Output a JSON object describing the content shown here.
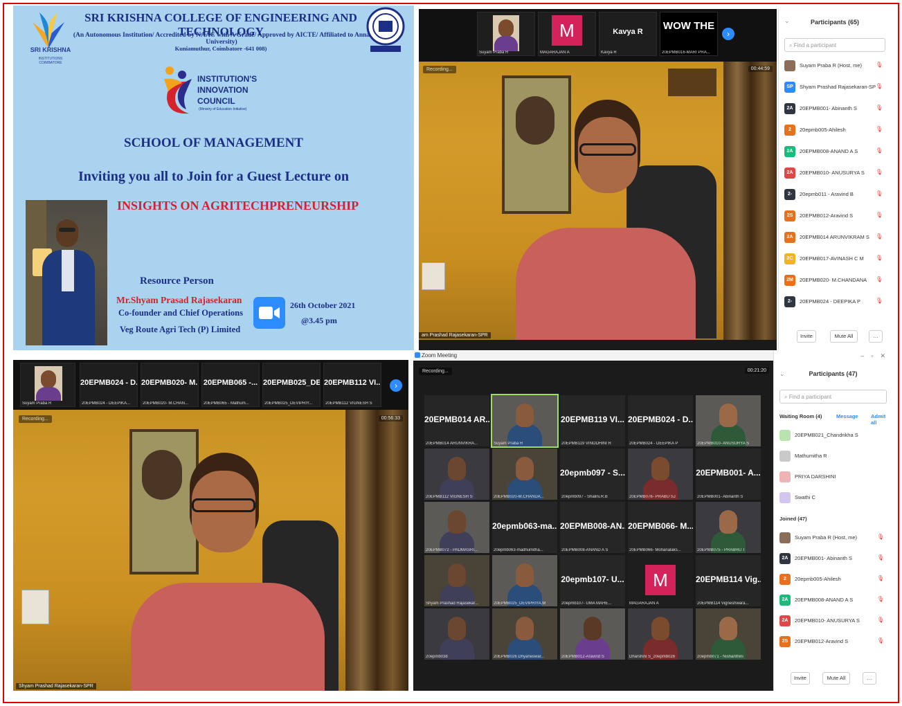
{
  "poster": {
    "logo_left_name": "SRI KRISHNA",
    "logo_left_sub": "INSTITUTIONS",
    "logo_left_sub2": "COIMBATORE",
    "college": "SRI KRISHNA COLLEGE OF ENGINEERING AND TECHNOLOGY",
    "accreditation": "(An Autonomous Institution/ Accredited by NAAC with A Grade/ Approved by AICTE/ Affiliated to Anna University)",
    "address": "Kuniamuthur, Coimbatore -641 008)",
    "iic_line1": "INSTITUTION'S",
    "iic_line2": "INNOVATION",
    "iic_line3": "COUNCIL",
    "iic_sub": "(Ministry of Education Initiative)",
    "school": "SCHOOL OF MANAGEMENT",
    "invite": "Inviting you all to Join for a Guest Lecture on",
    "topic": "INSIGHTS ON AGRITECHPRENEURSHIP",
    "resource_heading": "Resource Person",
    "person_name": "Mr.Shyam Prasad Rajasekaran",
    "person_role": "Co-founder and Chief Operations",
    "person_company": "Veg Route Agri Tech (P) Limited",
    "event_date": "26th October 2021",
    "event_time": "@3.45 pm"
  },
  "meeting1": {
    "thumbs": [
      {
        "name": "",
        "caption": "Suyam Praba R"
      },
      {
        "name": "M",
        "caption": "MAGARAJAN A"
      },
      {
        "name": "Kavya R",
        "caption": "Kavya R"
      },
      {
        "name": "WOW THE",
        "caption": "20EPMB016-MARI PRA..."
      }
    ],
    "recording": "Recording...",
    "timer": "00:44:59",
    "speaker_caption": "am Prashad Rajasekaran-SPR",
    "panel": {
      "title": "Participants (65)",
      "search_placeholder": "Find a participant",
      "rows": [
        {
          "initials": "",
          "name": "Suyam Praba R (Host, me)",
          "color": "#8b6d5a"
        },
        {
          "initials": "SP",
          "name": "Shyam Prashad Rajasekaran-SPR",
          "color": "#2d8cff"
        },
        {
          "initials": "2A",
          "name": "20EPMB001- Abinanth S",
          "color": "#2f3640"
        },
        {
          "initials": "2",
          "name": "20epmb005-Ahilesh",
          "color": "#e8711d"
        },
        {
          "initials": "2A",
          "name": "20EPMB008-ANAND A S",
          "color": "#1abc7c"
        },
        {
          "initials": "2A",
          "name": "20EPMB010- ANUSURYA S",
          "color": "#e04848"
        },
        {
          "initials": "2-",
          "name": "20epmb011 - Aravind B",
          "color": "#2f3640"
        },
        {
          "initials": "2S",
          "name": "20EPMB012-Aravind S",
          "color": "#e8711d"
        },
        {
          "initials": "2A",
          "name": "20EPMB014 ARUNVIKRAM S",
          "color": "#e8711d"
        },
        {
          "initials": "2C",
          "name": "20EPMB017-AVINASH C M",
          "color": "#f2b51d"
        },
        {
          "initials": "2M",
          "name": "20EPMB020- M.CHANDANA",
          "color": "#e8711d"
        },
        {
          "initials": "2-",
          "name": "20EPMB024 - DEEPIKA P",
          "color": "#2f3640"
        }
      ],
      "invite": "Invite",
      "mute_all": "Mute All"
    }
  },
  "meeting2": {
    "thumbs": [
      {
        "name": "",
        "caption": "Suyam Praba R"
      },
      {
        "name": "20EPMB024 - D...",
        "caption": "20EPMB024 - DEEPIKA..."
      },
      {
        "name": "20EPMB020- M...",
        "caption": "20EPMB020- M.CHAN..."
      },
      {
        "name": "20EPMB065 -...",
        "caption": "20EPMB065 - Mathum..."
      },
      {
        "name": "20EPMB025_DE...",
        "caption": "20EPMB025_DEVIPRIY..."
      },
      {
        "name": "20EPMB112 VI...",
        "caption": "20EPMB112 VIGNESH S"
      }
    ],
    "recording": "Recording...",
    "timer": "00:56:33",
    "speaker_caption": "Shyam Prashad Rajasekaran-SPR"
  },
  "meeting3": {
    "window_title": "Zoom Meeting",
    "recording": "Recording...",
    "timer": "00:21:20",
    "tiles": [
      {
        "name": "20EPMB014 AR...",
        "caption": "20EPMB014 ARUNVIKRA...",
        "video": false
      },
      {
        "name": "",
        "caption": "Suyam Praba R",
        "video": true
      },
      {
        "name": "20EPMB119 VI...",
        "caption": "20EPMB119 VINODHINI R",
        "video": false
      },
      {
        "name": "20EPMB024 - D...",
        "caption": "20EPMB024 - DEEPIKA P",
        "video": false
      },
      {
        "name": "",
        "caption": "20EPMB010- ANUSURYA S",
        "video": true
      },
      {
        "name": "",
        "caption": "20EPMB112 VIGNESH S",
        "video": true
      },
      {
        "name": "",
        "caption": "20EPMB020-M.CHANDA...",
        "video": true
      },
      {
        "name": "20epmb097 - S...",
        "caption": "20epmb097 - Shalini.R.B",
        "video": false
      },
      {
        "name": "",
        "caption": "20EPMB076- PRABU SJ",
        "video": true
      },
      {
        "name": "20EPMB001- A...",
        "caption": "20EPMB001- Abinanth S",
        "video": false
      },
      {
        "name": "",
        "caption": "20EPMB072 - PADMASRI...",
        "video": true
      },
      {
        "name": "20epmb063-ma...",
        "caption": "20epmb063-madhumitha...",
        "video": false
      },
      {
        "name": "20EPMB008-AN...",
        "caption": "20EPMB008-ANAND A S",
        "video": false
      },
      {
        "name": "20EPMB066- M...",
        "caption": "20EPMB066- Mohanalaks...",
        "video": false
      },
      {
        "name": "",
        "caption": "20EPMB075 - PRABHU T",
        "video": true
      },
      {
        "name": "",
        "caption": "Shyam Prashad Rajasekar...",
        "video": true
      },
      {
        "name": "",
        "caption": "20EPMB025_DEVIPRIYA.M",
        "video": true
      },
      {
        "name": "20epmb107- U...",
        "caption": "20epmb107- UMA MAHE...",
        "video": false
      },
      {
        "name": "M",
        "caption": "MAGARAJAN A",
        "video": false
      },
      {
        "name": "20EPMB114 Vig...",
        "caption": "20EPMB114 Vigneshwara...",
        "video": false
      },
      {
        "name": "",
        "caption": "20epmb038",
        "video": true
      },
      {
        "name": "",
        "caption": "20EPMB026 Dhyaneswar...",
        "video": true
      },
      {
        "name": "",
        "caption": "20EPMB012-Aravind S",
        "video": true
      },
      {
        "name": "",
        "caption": "Dharshini S_20epmb026",
        "video": true
      },
      {
        "name": "",
        "caption": "20epmb071 - Nishanthini",
        "video": true
      }
    ],
    "panel": {
      "title": "Participants (47)",
      "search_placeholder": "Find a participant",
      "waiting_label": "Waiting Room (4)",
      "message": "Message",
      "admit_all": "Admit all",
      "waiting": [
        {
          "name": "20EPMB021_Chandrikha S",
          "color": "#b9e4b0"
        },
        {
          "name": "Mathumitha R",
          "color": "#c9c9c9"
        },
        {
          "name": "PRIYA DARSHINI",
          "color": "#f0b3b3"
        },
        {
          "name": "Swathi C",
          "color": "#d3c4f0"
        }
      ],
      "joined_label": "Joined (47)",
      "rows": [
        {
          "initials": "",
          "name": "Suyam Praba R (Host, me)",
          "color": "#8b6d5a"
        },
        {
          "initials": "2A",
          "name": "20EPMB001- Abinanth S",
          "color": "#2f3640"
        },
        {
          "initials": "2",
          "name": "20epmb005-Ahilesh",
          "color": "#e8711d"
        },
        {
          "initials": "2A",
          "name": "20EPMB008-ANAND A S",
          "color": "#1abc7c"
        },
        {
          "initials": "2A",
          "name": "20EPMB010- ANUSURYA S",
          "color": "#e04848"
        },
        {
          "initials": "2S",
          "name": "20EPMB012-Aravind S",
          "color": "#e8711d"
        }
      ],
      "invite": "Invite",
      "mute_all": "Mute All"
    }
  }
}
